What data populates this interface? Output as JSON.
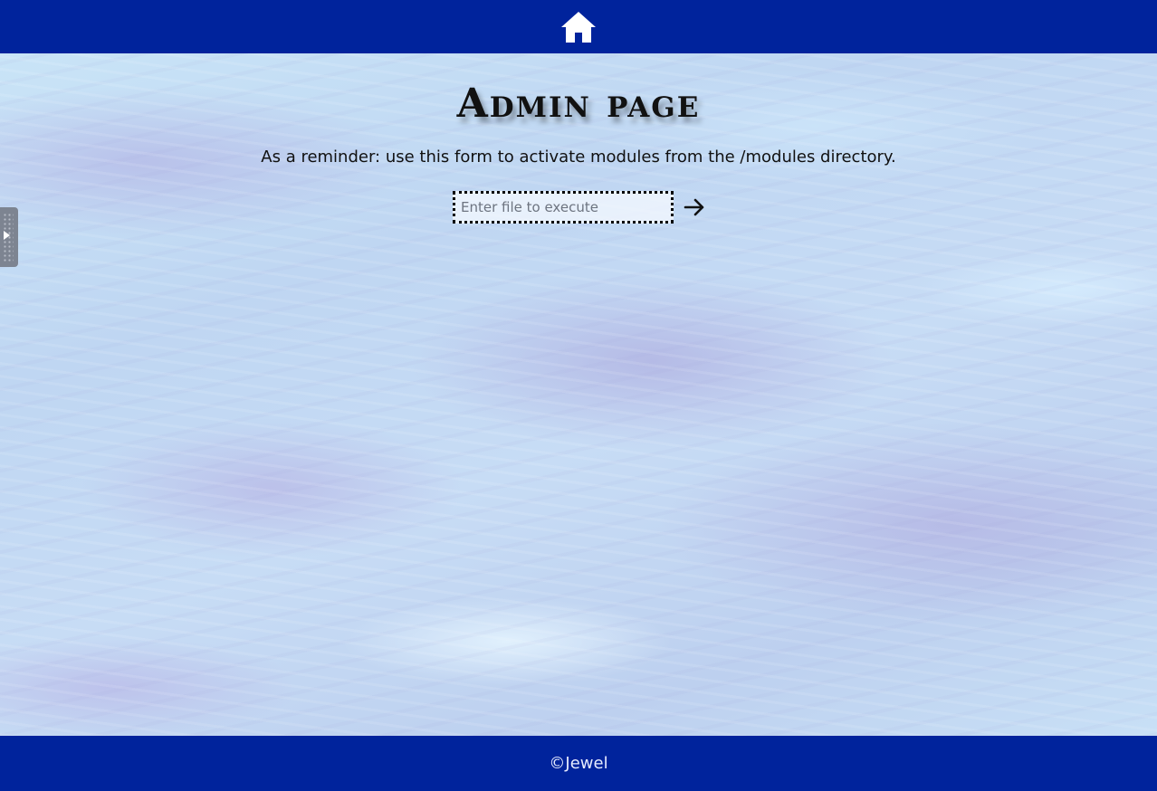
{
  "header": {
    "home_icon": "home-icon",
    "background_color": "#00239c"
  },
  "main": {
    "title": "Admin page",
    "reminder": "As a reminder: use this form to activate modules from the /modules directory.",
    "form": {
      "input_value": "",
      "input_placeholder": "Enter file to execute",
      "submit_icon": "arrow-right-icon"
    }
  },
  "side_panel": {
    "toggle_icon": "play-icon"
  },
  "footer": {
    "copyright": "©Jewel",
    "background_color": "#00239c"
  }
}
